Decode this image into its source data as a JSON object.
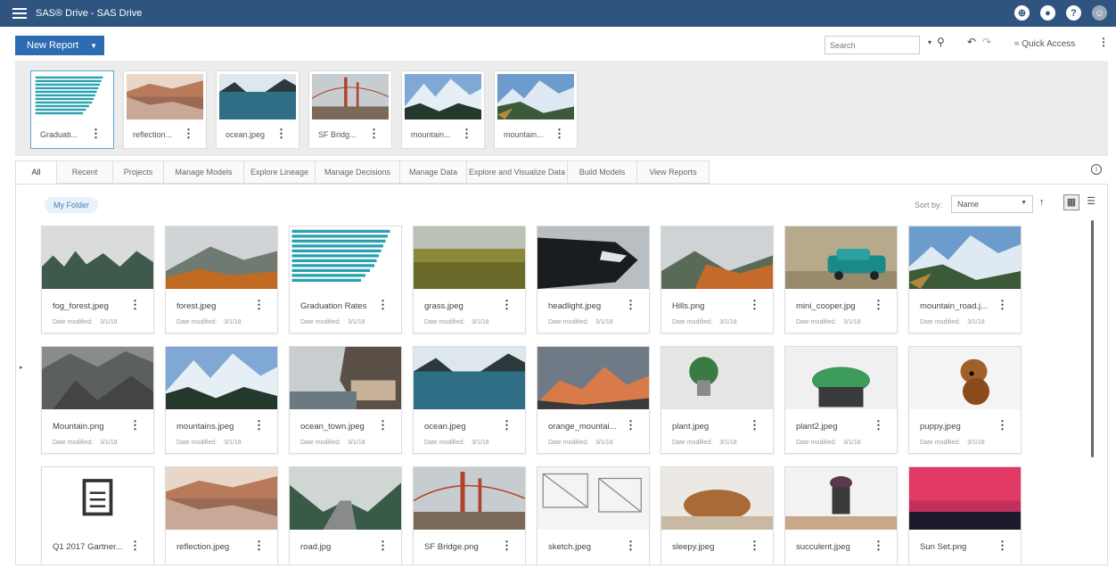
{
  "app": {
    "title": "SAS® Drive - SAS Drive"
  },
  "toolbar": {
    "new_report": "New Report",
    "search_placeholder": "Search",
    "quick_access": "Quick Access"
  },
  "recent": [
    {
      "name": "Graduati...",
      "thumb": "bars"
    },
    {
      "name": "reflection...",
      "thumb": "reflection"
    },
    {
      "name": "ocean.jpeg",
      "thumb": "ocean"
    },
    {
      "name": "SF Bridg...",
      "thumb": "bridge"
    },
    {
      "name": "mountain...",
      "thumb": "mountains"
    },
    {
      "name": "mountain...",
      "thumb": "mountains2"
    }
  ],
  "tabs": [
    "All",
    "Recent",
    "Projects",
    "Manage Models",
    "Explore Lineage",
    "Manage Decisions",
    "Manage Data",
    "Explore and Visualize Data",
    "Build Models",
    "View Reports"
  ],
  "folder": {
    "label": "My Folder"
  },
  "sort": {
    "label": "Sort by:",
    "value": "Name"
  },
  "files": [
    {
      "name": "fog_forest.jpeg",
      "date_label": "Date modified:",
      "date": "3/1/18",
      "thumb": "fog"
    },
    {
      "name": "forest.jpeg",
      "date_label": "Date modified:",
      "date": "3/1/18",
      "thumb": "forest"
    },
    {
      "name": "Graduation Rates",
      "date_label": "Date modified:",
      "date": "3/1/18",
      "thumb": "bars"
    },
    {
      "name": "grass.jpeg",
      "date_label": "Date modified:",
      "date": "3/1/18",
      "thumb": "grass"
    },
    {
      "name": "headlight.jpeg",
      "date_label": "Date modified:",
      "date": "3/1/18",
      "thumb": "car"
    },
    {
      "name": "Hills.png",
      "date_label": "Date modified:",
      "date": "3/1/18",
      "thumb": "hills"
    },
    {
      "name": "mini_cooper.jpg",
      "date_label": "Date modified:",
      "date": "3/1/18",
      "thumb": "mini"
    },
    {
      "name": "mountain_road.j...",
      "date_label": "Date modified:",
      "date": "3/1/18",
      "thumb": "mountains2"
    },
    {
      "name": "Mountain.png",
      "date_label": "Date modified:",
      "date": "3/1/18",
      "thumb": "rock"
    },
    {
      "name": "mountains.jpeg",
      "date_label": "Date modified:",
      "date": "3/1/18",
      "thumb": "mountains"
    },
    {
      "name": "ocean_town.jpeg",
      "date_label": "Date modified:",
      "date": "3/1/18",
      "thumb": "town"
    },
    {
      "name": "ocean.jpeg",
      "date_label": "Date modified:",
      "date": "3/1/18",
      "thumb": "ocean"
    },
    {
      "name": "orange_mountai...",
      "date_label": "Date modified:",
      "date": "3/1/18",
      "thumb": "orange"
    },
    {
      "name": "plant.jpeg",
      "date_label": "Date modified:",
      "date": "3/1/18",
      "thumb": "plant"
    },
    {
      "name": "plant2.jpeg",
      "date_label": "Date modified:",
      "date": "3/1/18",
      "thumb": "plant2"
    },
    {
      "name": "puppy.jpeg",
      "date_label": "Date modified:",
      "date": "3/1/18",
      "thumb": "puppy"
    },
    {
      "name": "Q1 2017 Gartner...",
      "date_label": "",
      "date": "",
      "thumb": "doc"
    },
    {
      "name": "reflection.jpeg",
      "date_label": "",
      "date": "",
      "thumb": "reflection"
    },
    {
      "name": "road.jpg",
      "date_label": "",
      "date": "",
      "thumb": "road"
    },
    {
      "name": "SF Bridge.png",
      "date_label": "",
      "date": "",
      "thumb": "bridge"
    },
    {
      "name": "sketch.jpeg",
      "date_label": "",
      "date": "",
      "thumb": "sketch"
    },
    {
      "name": "sleepy.jpeg",
      "date_label": "",
      "date": "",
      "thumb": "sleepy"
    },
    {
      "name": "succulent.jpeg",
      "date_label": "",
      "date": "",
      "thumb": "succulent"
    },
    {
      "name": "Sun Set.png",
      "date_label": "",
      "date": "",
      "thumb": "sunset"
    }
  ],
  "colors": {
    "header": "#2f5480",
    "accent": "#2d6cb2",
    "bars": "#2aa0b0"
  }
}
